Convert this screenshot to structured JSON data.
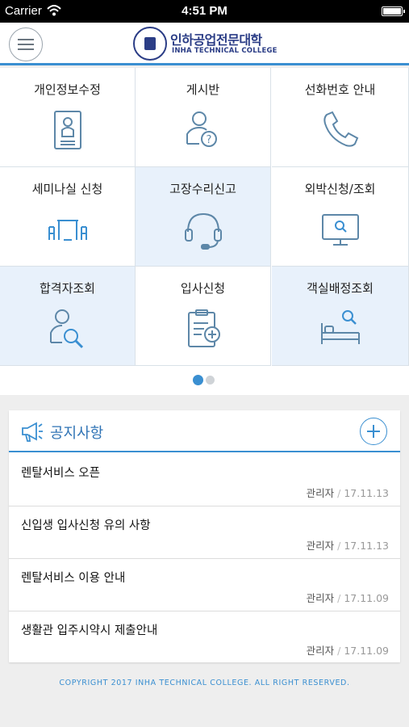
{
  "status_bar": {
    "carrier": "Carrier",
    "time": "4:51 PM"
  },
  "header": {
    "logo_korean": "인하공업전문대학",
    "logo_english": "INHA TECHNICAL COLLEGE"
  },
  "menu": [
    {
      "label": "개인정보수정",
      "icon": "id-card-icon",
      "highlight": true
    },
    {
      "label": "게시반",
      "icon": "user-question-icon",
      "highlight": false
    },
    {
      "label": "선화번호 안내",
      "icon": "phone-icon",
      "highlight": false
    },
    {
      "label": "세미나실 신청",
      "icon": "seminar-table-icon",
      "highlight": false
    },
    {
      "label": "고장수리신고",
      "icon": "headset-icon",
      "highlight": true
    },
    {
      "label": "외박신청/조회",
      "icon": "monitor-search-icon",
      "highlight": false
    },
    {
      "label": "합격자조회",
      "icon": "user-search-icon",
      "highlight": true
    },
    {
      "label": "입사신청",
      "icon": "clipboard-add-icon",
      "highlight": false
    },
    {
      "label": "객실배정조회",
      "icon": "bed-search-icon",
      "highlight": true
    }
  ],
  "pager": {
    "pages": 2,
    "current": 1
  },
  "notices": {
    "title": "공지사항",
    "items": [
      {
        "title": "렌탈서비스 오픈",
        "author": "관리자",
        "date": "17.11.13"
      },
      {
        "title": "신입생 입사신청 유의 사항",
        "author": "관리자",
        "date": "17.11.13"
      },
      {
        "title": "렌탈서비스 이용 안내",
        "author": "관리자",
        "date": "17.11.09"
      },
      {
        "title": "생활관 입주시약시 제출안내",
        "author": "관리자",
        "date": "17.11.09"
      }
    ]
  },
  "footer": {
    "copyright": "COPYRIGHT 2017 INHA TECHNICAL COLLEGE. ALL RIGHT RESERVED."
  },
  "colors": {
    "accent": "#3a8fd1",
    "highlight": "#e8f1fb",
    "icon": "#5d87a8"
  }
}
